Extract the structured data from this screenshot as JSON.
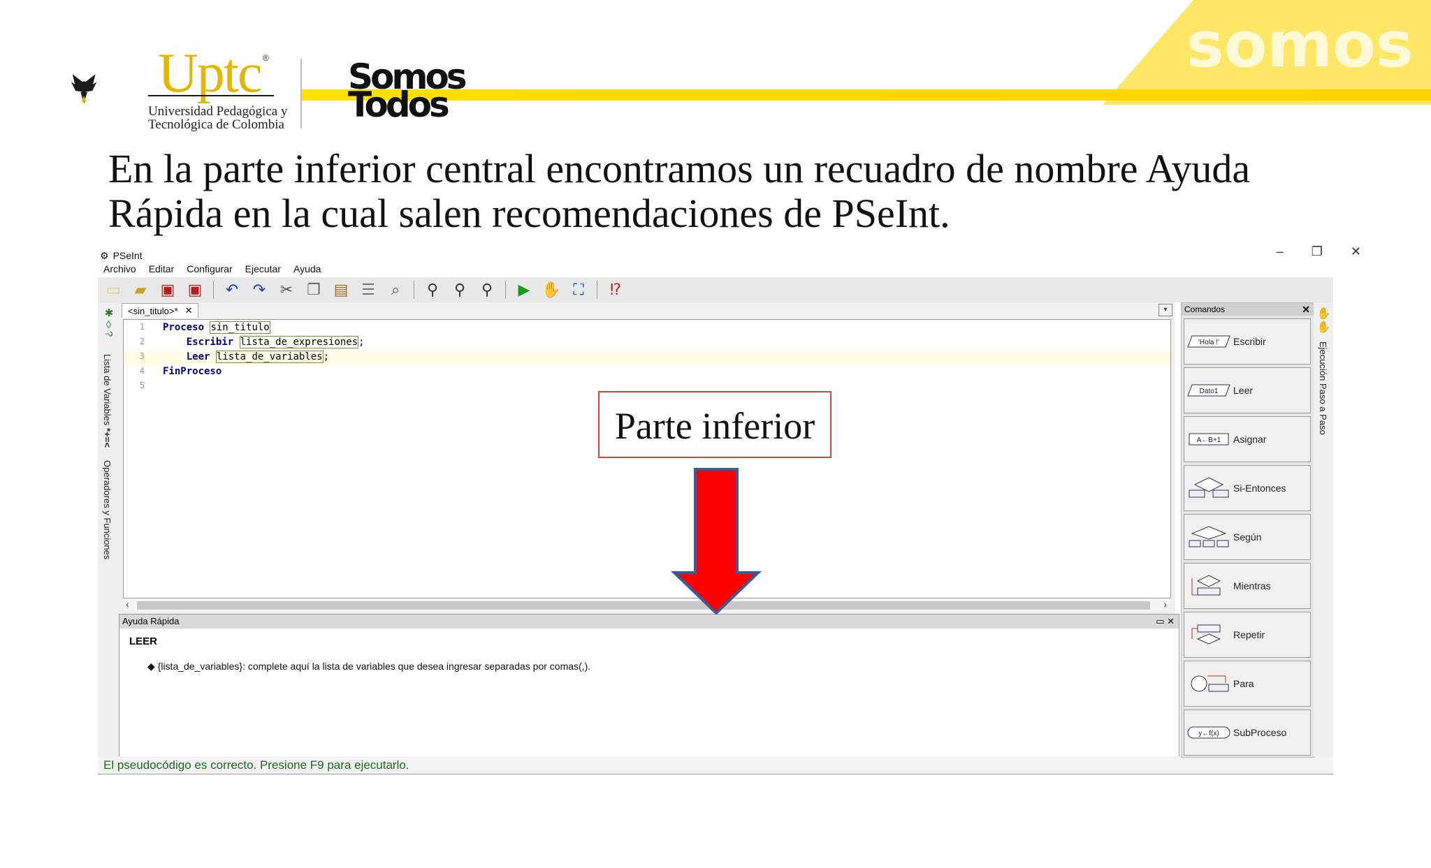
{
  "slide": {
    "university_name": "Uptc",
    "university_sub_1": "Universidad Pedagógica y",
    "university_sub_2": "Tecnológica de Colombia",
    "campaign_line_1": "Somos",
    "campaign_line_2": "Todos",
    "watermark": "somos todos",
    "title": "En la parte inferior central encontramos un recuadro de nombre Ayuda Rápida en la cual salen recomendaciones de PSeInt.",
    "accent_color": "#ffd200"
  },
  "window": {
    "title": "PSeInt",
    "minimize": "–",
    "restore": "❐",
    "close": "✕"
  },
  "menu": [
    "Archivo",
    "Editar",
    "Configurar",
    "Ejecutar",
    "Ayuda"
  ],
  "side_panels": {
    "variables": "Lista de Variables",
    "operators": "Operadores y Funciones",
    "step_by_step": "Ejecución Paso a Paso"
  },
  "editor": {
    "tab_label": "<sin_titulo>*",
    "tab_close": "✕",
    "lines": [
      {
        "num": "1",
        "kw": "Proceso",
        "arg": "sin_titulo",
        "tail": ""
      },
      {
        "num": "2",
        "kw": "Escribir",
        "arg": "lista_de_expresiones",
        "tail": ";"
      },
      {
        "num": "3",
        "kw": "Leer",
        "arg": "lista_de_variables",
        "tail": ";"
      },
      {
        "num": "4",
        "kw": "FinProceso",
        "arg": "",
        "tail": ""
      },
      {
        "num": "5",
        "kw": "",
        "arg": "",
        "tail": ""
      }
    ]
  },
  "ayuda": {
    "title": "Ayuda Rápida",
    "controls": "▭ ✕",
    "heading": "LEER",
    "body": "{lista_de_variables}: complete aquí la lista de variables que desea ingresar separadas por comas(,)."
  },
  "status": "El pseudocódigo es correcto. Presione F9 para ejecutarlo.",
  "comandos": {
    "title": "Comandos",
    "close": "✕",
    "items": [
      {
        "label": "Escribir",
        "icon_text": "'Hola !'"
      },
      {
        "label": "Leer",
        "icon_text": "Dato1"
      },
      {
        "label": "Asignar",
        "icon_text": "A←B+1"
      },
      {
        "label": "Si-Entonces",
        "icon_text": ""
      },
      {
        "label": "Según",
        "icon_text": ""
      },
      {
        "label": "Mientras",
        "icon_text": ""
      },
      {
        "label": "Repetir",
        "icon_text": ""
      },
      {
        "label": "Para",
        "icon_text": ""
      },
      {
        "label": "SubProceso",
        "icon_text": "y←f(x)"
      }
    ]
  },
  "annotation": {
    "callout": "Parte inferior",
    "arrow_color": "#ff0000"
  }
}
